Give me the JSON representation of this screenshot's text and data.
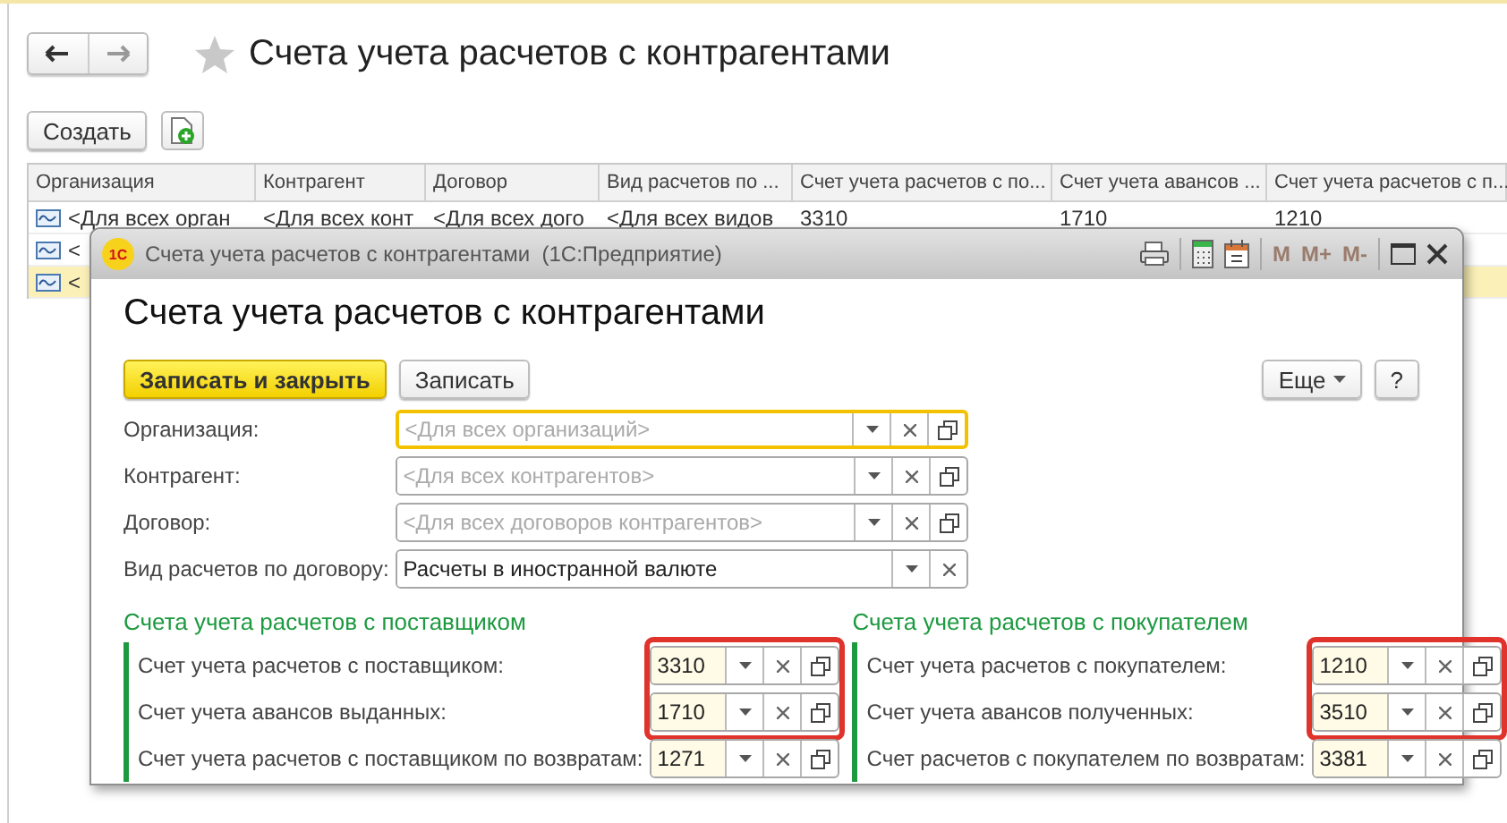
{
  "main_window": {
    "title": "Счета учета расчетов с контрагентами",
    "create_button": "Создать"
  },
  "table": {
    "columns": [
      "Организация",
      "Контрагент",
      "Договор",
      "Вид расчетов по ...",
      "Счет учета расчетов с по...",
      "Счет учета авансов ...",
      "Счет учета расчетов с п..."
    ],
    "rows": [
      {
        "cells": [
          "<Для всех орган",
          "<Для всех конт",
          "<Для всех дого",
          "<Для всех видов",
          "3310",
          "1710",
          "1210"
        ],
        "selected": false
      },
      {
        "cells": [
          "<"
        ],
        "selected": false
      },
      {
        "cells": [
          "<"
        ],
        "selected": true
      }
    ]
  },
  "dialog": {
    "logo_text": "1С",
    "window_title": "Счета учета расчетов с контрагентами  (1С:Предприятие)",
    "memory_buttons": [
      {
        "label": "M",
        "disabled": true
      },
      {
        "label": "M+",
        "disabled": true
      },
      {
        "label": "M-",
        "disabled": true
      }
    ],
    "heading": "Счета учета расчетов с контрагентами",
    "buttons": [
      {
        "label": "Записать и закрыть",
        "kind": "primary"
      },
      {
        "label": "Записать",
        "kind": "default"
      }
    ],
    "more_button": "Еще",
    "help_button": "?",
    "fields": [
      {
        "label": "Организация:",
        "placeholder": "<Для всех организаций>",
        "kind": "reference",
        "focused": true
      },
      {
        "label": "Контрагент:",
        "placeholder": "<Для всех контрагентов>",
        "kind": "reference",
        "focused": false
      },
      {
        "label": "Договор:",
        "placeholder": "<Для всех договоров контрагентов>",
        "kind": "reference",
        "focused": false
      },
      {
        "label": "Вид расчетов по договору:",
        "value": "Расчеты в иностранной валюте",
        "kind": "enum",
        "focused": false
      }
    ],
    "groups": [
      {
        "title": "Счета учета расчетов с поставщиком",
        "rows": [
          {
            "label": "Счет учета расчетов с поставщиком:",
            "value": "3310",
            "highlighted": true
          },
          {
            "label": "Счет учета авансов выданных:",
            "value": "1710",
            "highlighted": true
          },
          {
            "label": "Счет учета расчетов с поставщиком по возвратам:",
            "value": "1271",
            "highlighted": false
          }
        ]
      },
      {
        "title": "Счета учета расчетов с покупателем",
        "rows": [
          {
            "label": "Счет учета расчетов с покупателем:",
            "value": "1210",
            "highlighted": true
          },
          {
            "label": "Счет учета авансов полученных:",
            "value": "3510",
            "highlighted": true
          },
          {
            "label": "Счет расчетов с покупателем по возвратам:",
            "value": "3381",
            "highlighted": false
          }
        ]
      }
    ]
  }
}
